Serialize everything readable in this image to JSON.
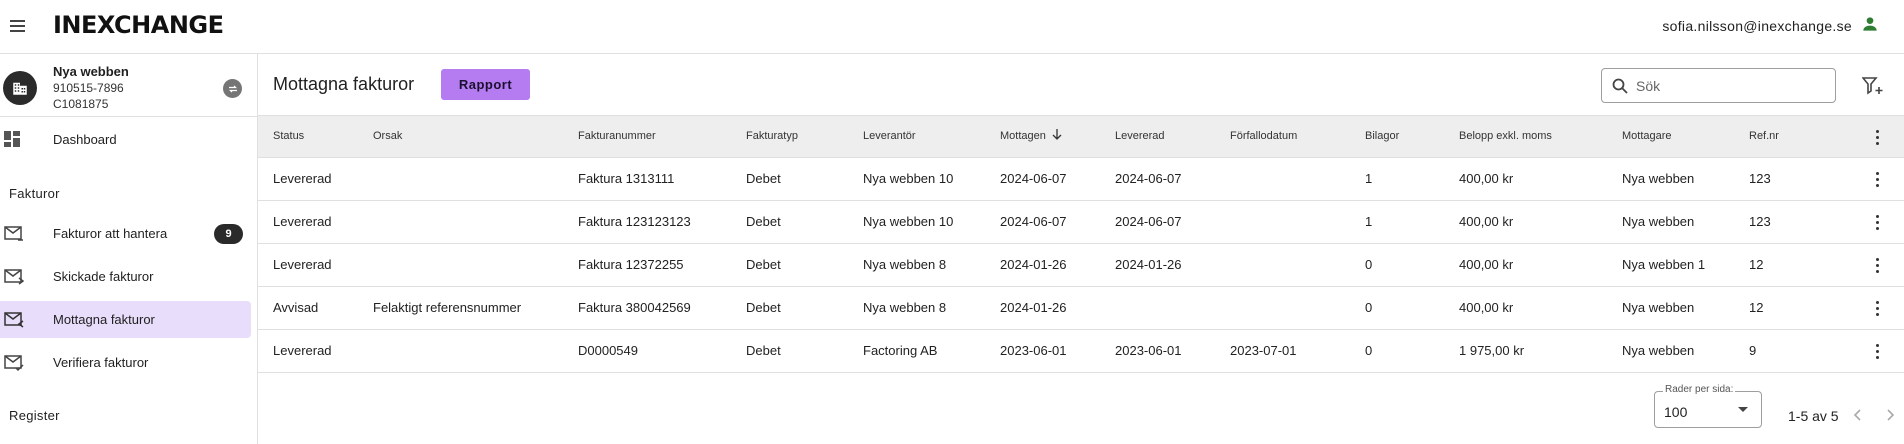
{
  "app": {
    "logo": "INEXCHANGE",
    "user_email": "sofia.nilsson@inexchange.se"
  },
  "org": {
    "name": "Nya webben",
    "id": "910515-7896",
    "code": "C1081875"
  },
  "nav": {
    "dashboard": "Dashboard",
    "section_fakturor": "Fakturor",
    "items": [
      {
        "label": "Fakturor att hantera",
        "badge": "9"
      },
      {
        "label": "Skickade fakturor"
      },
      {
        "label": "Mottagna fakturor"
      },
      {
        "label": "Verifiera fakturor"
      }
    ],
    "section_register": "Register"
  },
  "page": {
    "title": "Mottagna fakturor",
    "rapport_label": "Rapport",
    "search_placeholder": "Sök"
  },
  "table": {
    "columns": [
      "Status",
      "Orsak",
      "Fakturanummer",
      "Fakturatyp",
      "Leverantör",
      "Mottagen",
      "Levererad",
      "Förfallodatum",
      "Bilagor",
      "Belopp exkl. moms",
      "Mottagare",
      "Ref.nr"
    ],
    "sort_column": "Mottagen",
    "rows": [
      [
        "Levererad",
        "",
        "Faktura 1313111",
        "Debet",
        "Nya webben 10",
        "2024-06-07",
        "2024-06-07",
        "",
        "1",
        "400,00 kr",
        "Nya webben",
        "123"
      ],
      [
        "Levererad",
        "",
        "Faktura 123123123",
        "Debet",
        "Nya webben 10",
        "2024-06-07",
        "2024-06-07",
        "",
        "1",
        "400,00 kr",
        "Nya webben",
        "123"
      ],
      [
        "Levererad",
        "",
        "Faktura 12372255",
        "Debet",
        "Nya webben 8",
        "2024-01-26",
        "2024-01-26",
        "",
        "0",
        "400,00 kr",
        "Nya webben 1",
        "12"
      ],
      [
        "Avvisad",
        "Felaktigt referensnummer",
        "Faktura 380042569",
        "Debet",
        "Nya webben 8",
        "2024-01-26",
        "",
        "",
        "0",
        "400,00 kr",
        "Nya webben",
        "12"
      ],
      [
        "Levererad",
        "",
        "D0000549",
        "Debet",
        "Factoring AB",
        "2023-06-01",
        "2023-06-01",
        "2023-07-01",
        "0",
        "1 975,00 kr",
        "Nya webben",
        "9"
      ]
    ]
  },
  "pagination": {
    "rows_per_page_label": "Rader per sida:",
    "rows_per_page": "100",
    "range": "1-5 av 5"
  },
  "colors": {
    "accent": "#b57cf2",
    "active_nav": "#e8ddfb",
    "user_icon": "#2e7d32"
  }
}
